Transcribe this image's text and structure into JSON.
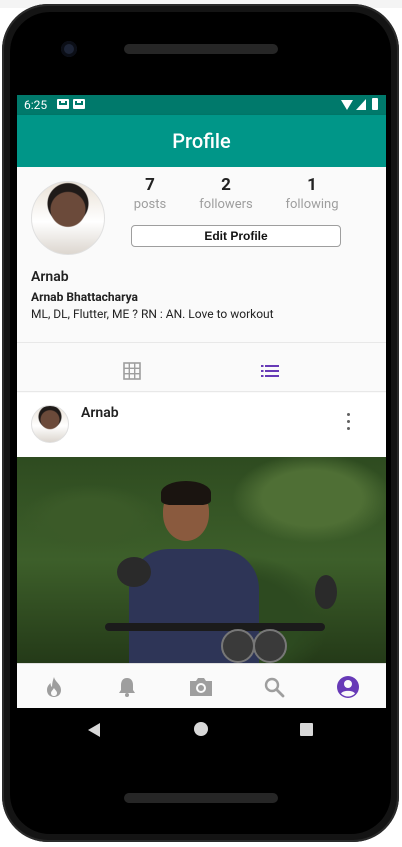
{
  "status_bar": {
    "time": "6:25"
  },
  "app_bar": {
    "title": "Profile"
  },
  "profile": {
    "stats": [
      {
        "value": "7",
        "label": "posts"
      },
      {
        "value": "2",
        "label": "followers"
      },
      {
        "value": "1",
        "label": "following"
      }
    ],
    "edit_button_label": "Edit Profile",
    "username": "Arnab",
    "full_name": "Arnab Bhattacharya",
    "bio": "ML, DL, Flutter, ME ? RN : AN. Love to workout"
  },
  "post": {
    "author": "Arnab"
  },
  "colors": {
    "status_bar": "#00796b",
    "app_bar": "#009688",
    "accent": "#673ab7",
    "inactive_icon": "#9e9e9e"
  },
  "bottom_nav": {
    "items": [
      {
        "icon": "flame-icon",
        "active": false
      },
      {
        "icon": "bell-icon",
        "active": false
      },
      {
        "icon": "camera-icon",
        "active": false
      },
      {
        "icon": "search-icon",
        "active": false
      },
      {
        "icon": "account-icon",
        "active": true
      }
    ]
  }
}
